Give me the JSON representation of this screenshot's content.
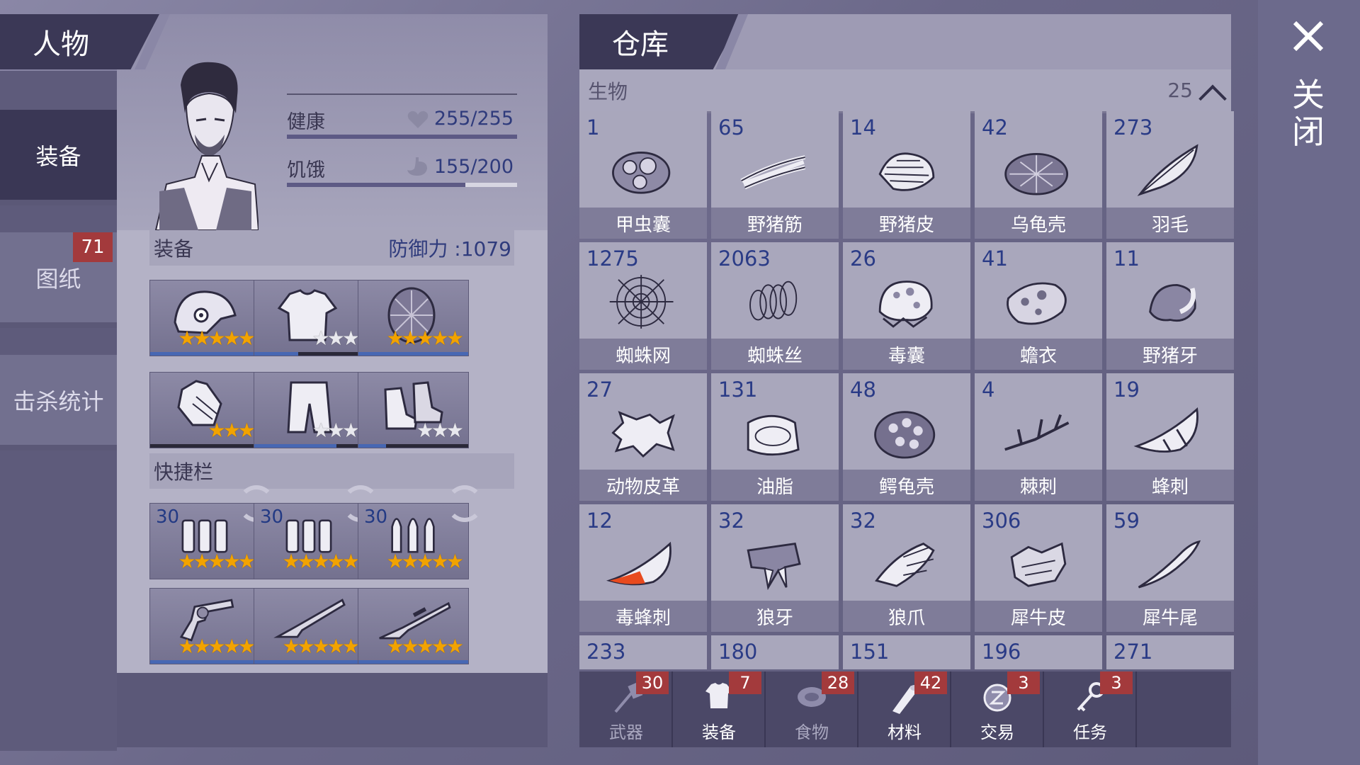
{
  "header": {
    "character_title": "人物",
    "warehouse_title": "仓库"
  },
  "sidebar": {
    "tabs": [
      {
        "label": "装备"
      },
      {
        "label": "图纸",
        "badge": "71"
      },
      {
        "label": "击杀统计"
      }
    ]
  },
  "stats": {
    "health_label": "健康",
    "health_value": "255/255",
    "health_fraction": 1.0,
    "hunger_label": "饥饿",
    "hunger_value": "155/200",
    "hunger_fraction": 0.775
  },
  "equipment": {
    "section_label": "装备",
    "defense_label": "防御力 :1079",
    "slots": [
      {
        "item": "helmet-icon",
        "stars": 5,
        "max_stars": 5,
        "durability": 1.0
      },
      {
        "item": "shirt-icon",
        "stars": 3,
        "max_stars": 3,
        "durability": 0.4
      },
      {
        "item": "turtle-armor-icon",
        "stars": 5,
        "max_stars": 5,
        "durability": 1.0
      },
      {
        "item": "gloves-icon",
        "stars": 3,
        "max_stars": 3,
        "durability": 0.0
      },
      {
        "item": "pants-icon",
        "stars": 3,
        "max_stars": 3,
        "durability": 0.75
      },
      {
        "item": "boots-icon",
        "stars": 3,
        "max_stars": 3,
        "durability": 0.25
      }
    ]
  },
  "quickbar": {
    "section_label": "快捷栏",
    "ammo": [
      {
        "count": "30",
        "stars": 5,
        "item": "ammo-icon"
      },
      {
        "count": "30",
        "stars": 5,
        "item": "ammo-icon"
      },
      {
        "count": "30",
        "stars": 5,
        "item": "rifle-ammo-icon"
      }
    ],
    "weapons": [
      {
        "item": "revolver-icon",
        "stars": 5,
        "durability": 1.0
      },
      {
        "item": "shotgun-icon",
        "stars": 5,
        "durability": 1.0
      },
      {
        "item": "rifle-icon",
        "stars": 5,
        "durability": 1.0
      }
    ]
  },
  "warehouse": {
    "category": "生物",
    "category_count": "25",
    "items": [
      {
        "qty": "1",
        "name": "甲虫囊",
        "icon": "beetle-sac-icon"
      },
      {
        "qty": "65",
        "name": "野猪筋",
        "icon": "boar-tendon-icon"
      },
      {
        "qty": "14",
        "name": "野猪皮",
        "icon": "boar-hide-icon"
      },
      {
        "qty": "42",
        "name": "乌龟壳",
        "icon": "turtle-shell-icon"
      },
      {
        "qty": "273",
        "name": "羽毛",
        "icon": "feather-icon"
      },
      {
        "qty": "1275",
        "name": "蜘蛛网",
        "icon": "spider-web-icon"
      },
      {
        "qty": "2063",
        "name": "蜘蛛丝",
        "icon": "spider-silk-icon"
      },
      {
        "qty": "26",
        "name": "毒囊",
        "icon": "poison-sac-icon"
      },
      {
        "qty": "41",
        "name": "蟾衣",
        "icon": "toad-skin-icon"
      },
      {
        "qty": "11",
        "name": "野猪牙",
        "icon": "boar-tusk-icon"
      },
      {
        "qty": "27",
        "name": "动物皮革",
        "icon": "leather-icon"
      },
      {
        "qty": "131",
        "name": "油脂",
        "icon": "fat-icon"
      },
      {
        "qty": "48",
        "name": "鳄龟壳",
        "icon": "snapping-turtle-shell-icon"
      },
      {
        "qty": "4",
        "name": "棘刺",
        "icon": "thorn-icon"
      },
      {
        "qty": "19",
        "name": "蜂刺",
        "icon": "bee-stinger-icon"
      },
      {
        "qty": "12",
        "name": "毒蜂刺",
        "icon": "wasp-stinger-icon"
      },
      {
        "qty": "32",
        "name": "狼牙",
        "icon": "wolf-fang-icon"
      },
      {
        "qty": "32",
        "name": "狼爪",
        "icon": "wolf-claw-icon"
      },
      {
        "qty": "306",
        "name": "犀牛皮",
        "icon": "rhino-hide-icon"
      },
      {
        "qty": "59",
        "name": "犀牛尾",
        "icon": "rhino-tail-icon"
      }
    ],
    "partial_row": [
      "233",
      "180",
      "151",
      "196",
      "271"
    ]
  },
  "bottom_tabs": [
    {
      "label": "武器",
      "badge": "30",
      "icon": "axe-icon"
    },
    {
      "label": "装备",
      "badge": "7",
      "icon": "shirt-icon"
    },
    {
      "label": "食物",
      "badge": "28",
      "icon": "meat-icon"
    },
    {
      "label": "材料",
      "badge": "42",
      "icon": "log-icon"
    },
    {
      "label": "交易",
      "badge": "3",
      "icon": "coin-icon"
    },
    {
      "label": "任务",
      "badge": "3",
      "icon": "key-icon"
    }
  ],
  "close": {
    "label": "关闭"
  },
  "colors": {
    "accent_blue": "#2a3b86",
    "badge_red": "#a33a3c",
    "star_gold": "#f2a300"
  }
}
